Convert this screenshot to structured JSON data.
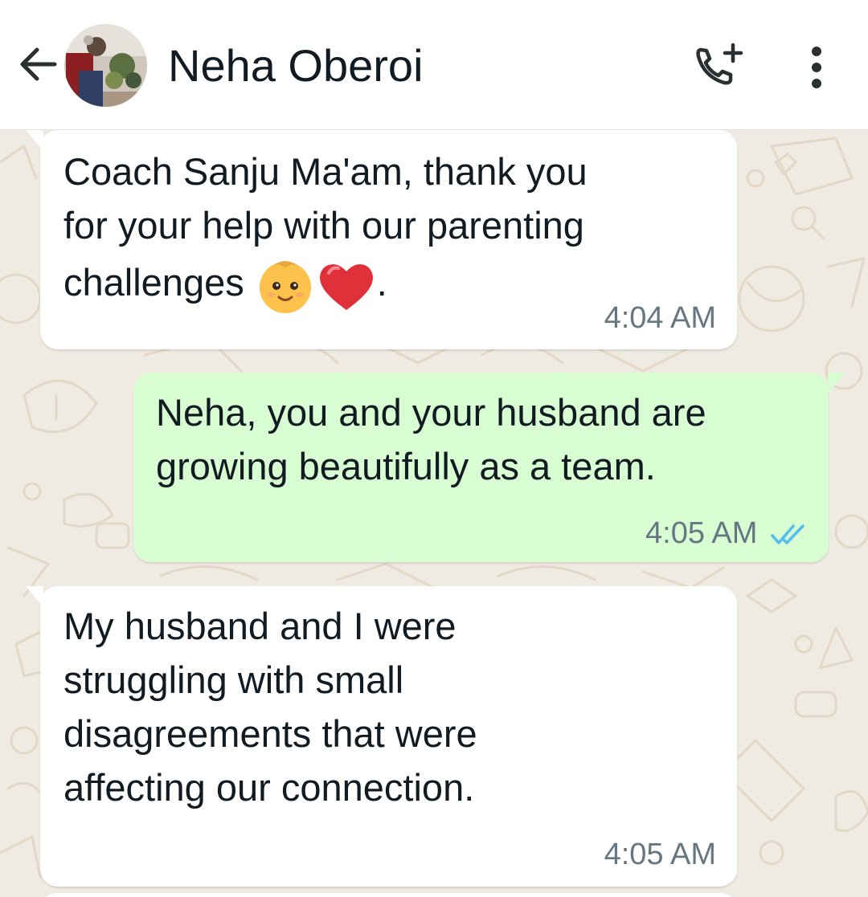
{
  "header": {
    "contact_name": "Neha Oberoi",
    "back_icon": "arrow-left-icon",
    "call_icon": "add-call-icon",
    "menu_icon": "more-vertical-icon"
  },
  "messages": [
    {
      "direction": "incoming",
      "lines": [
        "Coach Sanju Ma'am, thank you",
        "for your help with our parenting"
      ],
      "last_line_text": "challenges ",
      "last_line_suffix": ".",
      "emojis": [
        "baby-face-emoji",
        "red-heart-emoji"
      ],
      "time": "4:04 AM"
    },
    {
      "direction": "outgoing",
      "lines": [
        "Neha, you and your husband are",
        "growing beautifully as a team."
      ],
      "time": "4:05 AM",
      "status": "read",
      "status_icon": "double-check-icon"
    },
    {
      "direction": "incoming",
      "lines": [
        "My husband and I were",
        "struggling with small",
        "disagreements that were",
        "affecting our connection."
      ],
      "time": "4:05 AM"
    }
  ],
  "colors": {
    "incoming_bubble": "#ffffff",
    "outgoing_bubble": "#d9fdd3",
    "chat_background": "#efeae2",
    "read_ticks": "#53bdeb",
    "timestamp": "#667781"
  }
}
